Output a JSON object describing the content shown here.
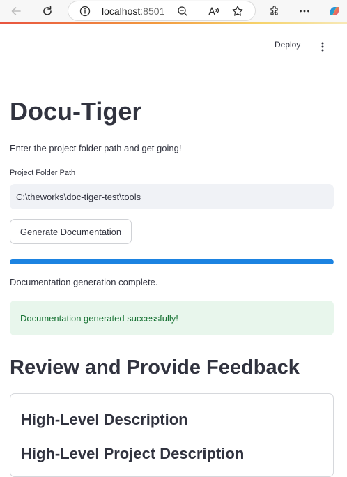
{
  "browser": {
    "url_host": "localhost",
    "url_port": ":8501",
    "icons": [
      "back-arrow-icon",
      "refresh-icon",
      "info-icon",
      "zoom-out-icon",
      "read-aloud-icon",
      "favorite-star-icon",
      "extensions-icon",
      "more-icon",
      "copilot-icon"
    ],
    "gradient_colors": [
      "#e8533f",
      "#f29a3f",
      "#f6d36b",
      "#f7e9b8"
    ]
  },
  "header": {
    "deploy_label": "Deploy",
    "menu_icon": "vertical-dots-icon"
  },
  "main": {
    "title": "Docu-Tiger",
    "intro": "Enter the project folder path and get going!",
    "folder_field": {
      "label": "Project Folder Path",
      "value": "C:\\theworks\\doc-tiger-test\\tools"
    },
    "generate_button": "Generate Documentation",
    "progress": {
      "percent": 100,
      "color": "#1c83e1"
    },
    "status": "Documentation generation complete.",
    "success_alert": {
      "text": "Documentation generated successfully!",
      "background": "#e8f6ec",
      "text_color": "#177233"
    },
    "review": {
      "heading": "Review and Provide Feedback",
      "card_heading": "High-Level Description",
      "card_subheading": "High-Level Project Description"
    }
  }
}
